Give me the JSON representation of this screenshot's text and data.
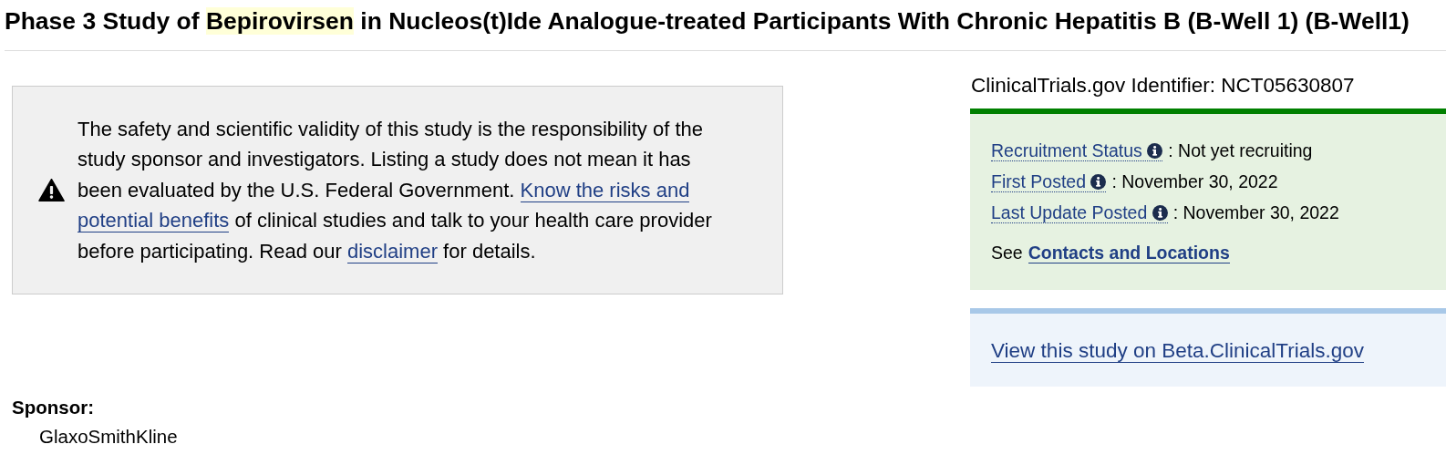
{
  "title": {
    "before": "Phase 3 Study of ",
    "highlight": "Bepirovirsen",
    "after": " in Nucleos(t)Ide Analogue-treated Participants With Chronic Hepatitis B (B-Well 1) (B-Well1)"
  },
  "disclaimer": {
    "parts": [
      {
        "kind": "text",
        "text": "The safety and scientific validity of this study is the responsibility of the study sponsor and investigators. Listing a study does not mean it has been evaluated by the U.S. Federal Government. "
      },
      {
        "kind": "link",
        "text": "Know the risks and"
      },
      {
        "kind": "link",
        "text": "potential benefits"
      },
      {
        "kind": "text",
        "text": " of clinical studies and talk to your health care provider before participating. Read our "
      },
      {
        "kind": "link",
        "text": "disclaimer"
      },
      {
        "kind": "text",
        "text": " for details."
      }
    ]
  },
  "identifier": "ClinicalTrials.gov Identifier: NCT05630807",
  "status_rows": [
    {
      "label": "Recruitment Status",
      "value": ": Not yet recruiting"
    },
    {
      "label": "First Posted",
      "value": ": November 30, 2022"
    },
    {
      "label": "Last Update Posted",
      "value": ": November 30, 2022"
    }
  ],
  "see": {
    "text": "See",
    "link": "Contacts and Locations"
  },
  "beta_link": "View this study on Beta.ClinicalTrials.gov",
  "sponsor": {
    "heading": "Sponsor:",
    "name": "GlaxoSmithKline"
  }
}
